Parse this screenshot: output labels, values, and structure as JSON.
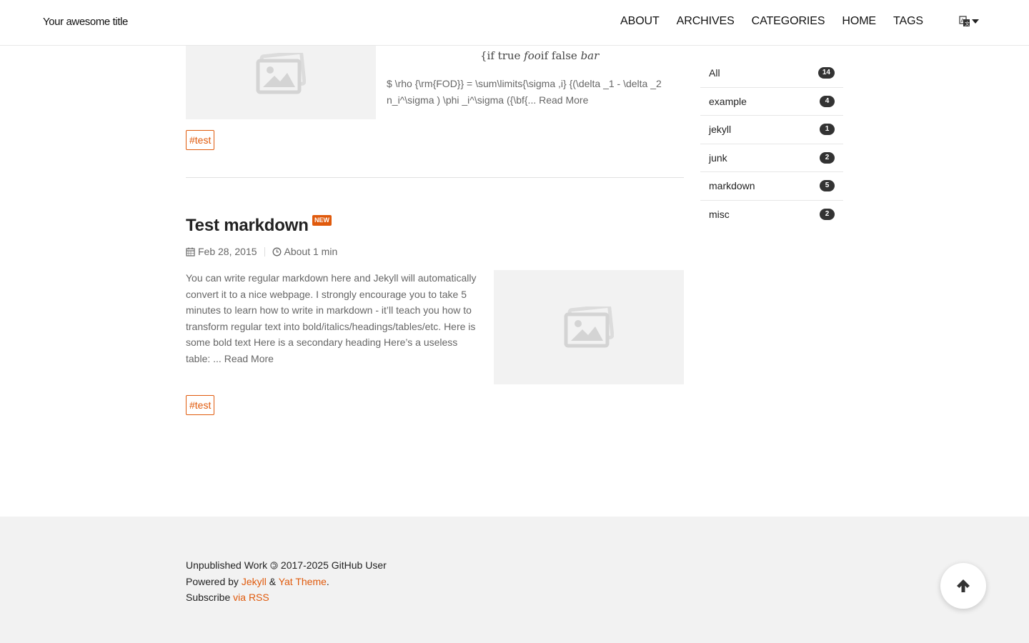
{
  "header": {
    "site_title": "Your awesome title",
    "nav": [
      "ABOUT",
      "ARCHIVES",
      "CATEGORIES",
      "HOME",
      "TAGS"
    ],
    "language_icon": "translate-icon"
  },
  "post1": {
    "math_prefix": "{if true ",
    "math_foo": "foo",
    "math_mid": "if false ",
    "math_bar": "bar",
    "excerpt": "$ \\rho {\\rm{FOD}} = \\sum\\limits{\\sigma ,i} {(\\delta _1 - \\delta _2 n_i^\\sigma ) \\phi _i^\\sigma ({\\bf{...",
    "read_more": "Read More",
    "tag": "#test"
  },
  "post2": {
    "title": "Test markdown",
    "badge": "NEW",
    "date": "Feb 28, 2015",
    "read_time": "About 1 min",
    "excerpt": "You can write regular markdown here and Jekyll will automatically convert it to a nice webpage. I strongly encourage you to take 5 minutes to learn how to write in markdown - it’ll teach you how to transform regular text into bold/italics/headings/tables/etc. Here is some bold text Here is a secondary heading Here’s a useless table: ...",
    "read_more": "Read More",
    "tag": "#test"
  },
  "sidebar": {
    "categories": [
      {
        "name": "All",
        "count": "14"
      },
      {
        "name": "example",
        "count": "4"
      },
      {
        "name": "jekyll",
        "count": "1"
      },
      {
        "name": "junk",
        "count": "2"
      },
      {
        "name": "markdown",
        "count": "5"
      },
      {
        "name": "misc",
        "count": "2"
      }
    ]
  },
  "footer": {
    "copyright_pre": "Unpublished Work",
    "copyright_post": "2017-2025 GitHub User",
    "powered_by": "Powered by",
    "jekyll_link": "Jekyll",
    "amp": "&",
    "theme_link": "Yat Theme",
    "period": ".",
    "subscribe": "Subscribe",
    "rss_link": "via RSS"
  },
  "colors": {
    "accent": "#e05a0c",
    "badge_bg": "#333333",
    "footer_bg": "#f2f2f2"
  }
}
